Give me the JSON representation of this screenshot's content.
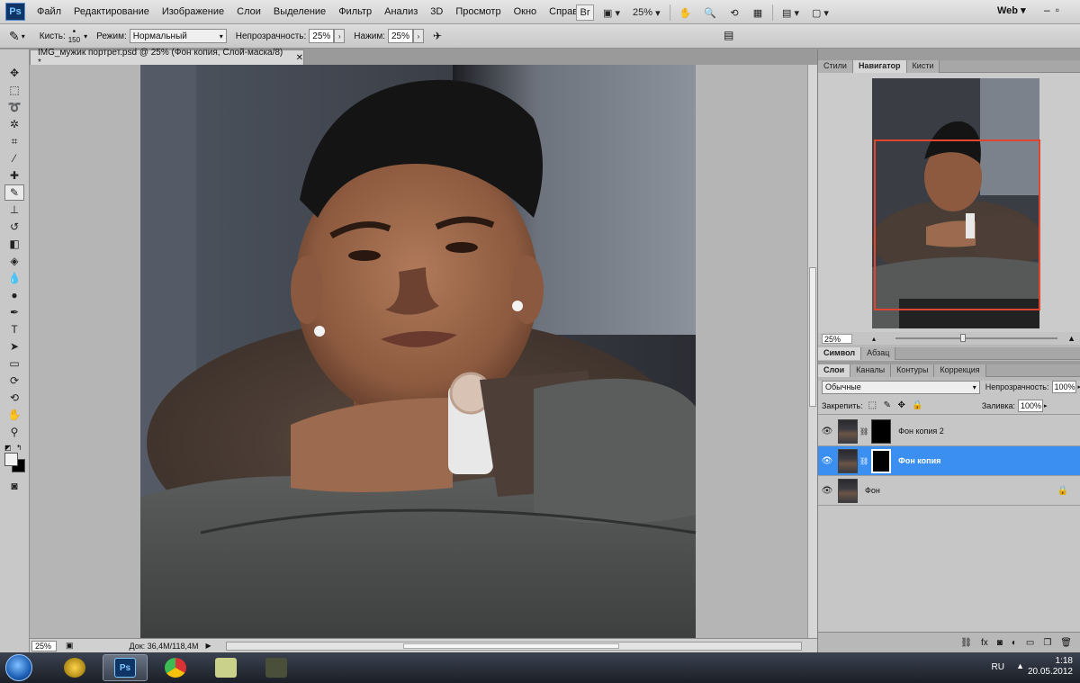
{
  "app": {
    "logo": "Ps",
    "menu": [
      "Файл",
      "Редактирование",
      "Изображение",
      "Слои",
      "Выделение",
      "Фильтр",
      "Анализ",
      "3D",
      "Просмотр",
      "Окно",
      "Справка"
    ],
    "toolbar_zoom": "25%",
    "workspace": "Web"
  },
  "options": {
    "brush_label": "Кисть:",
    "brush_size": "150",
    "mode_label": "Режим:",
    "mode_value": "Нормальный",
    "opacity_label": "Непрозрачность:",
    "opacity_value": "25%",
    "flow_label": "Нажим:",
    "flow_value": "25%"
  },
  "document": {
    "tab_title": "IMG_мужик портрет.psd @ 25% (Фон копия, Слой-маска/8) *",
    "status_zoom": "25%",
    "status_doc": "Док: 36,4M/118,4M"
  },
  "navigator": {
    "tabs": [
      "Стили",
      "Навигатор",
      "Кисти"
    ],
    "active_tab": "Навигатор",
    "zoom": "25%"
  },
  "text_panel": {
    "tabs": [
      "Символ",
      "Абзац"
    ]
  },
  "layers": {
    "tabs": [
      "Слои",
      "Каналы",
      "Контуры",
      "Коррекция"
    ],
    "blend_mode": "Обычные",
    "opacity_label": "Непрозрачность:",
    "opacity_value": "100%",
    "lock_label": "Закрепить:",
    "fill_label": "Заливка:",
    "fill_value": "100%",
    "items": [
      {
        "name": "Фон копия 2",
        "selected": false
      },
      {
        "name": "Фон копия",
        "selected": true
      },
      {
        "name": "Фон",
        "selected": false
      }
    ]
  },
  "taskbar": {
    "lang": "RU",
    "time": "1:18",
    "date": "20.05.2012"
  }
}
